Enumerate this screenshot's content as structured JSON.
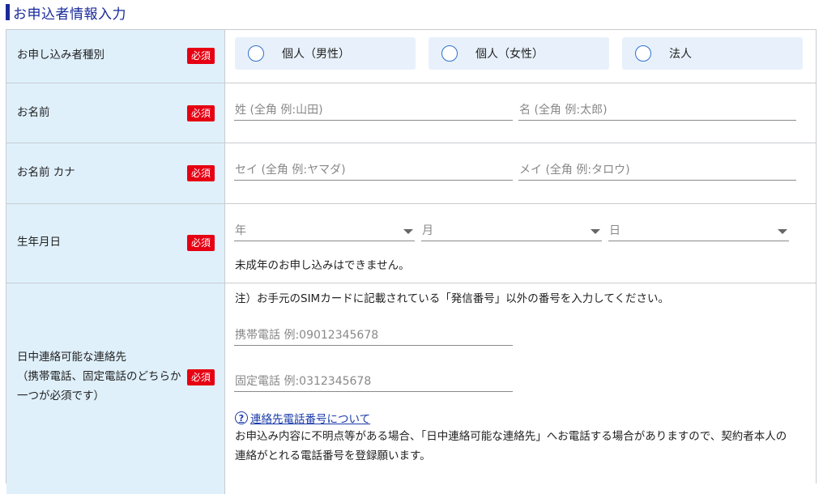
{
  "header": {
    "title": "お申込者情報入力"
  },
  "required_label": "必須",
  "rows": {
    "applicant_type": {
      "label": "お申し込み者種別",
      "options": [
        {
          "label": "個人（男性）"
        },
        {
          "label": "個人（女性）"
        },
        {
          "label": "法人"
        }
      ]
    },
    "name": {
      "label": "お名前",
      "last_placeholder": "姓 (全角 例:山田)",
      "first_placeholder": "名 (全角 例:太郎)"
    },
    "name_kana": {
      "label": "お名前 カナ",
      "last_placeholder": "セイ (全角 例:ヤマダ)",
      "first_placeholder": "メイ (全角 例:タロウ)"
    },
    "birthdate": {
      "label": "生年月日",
      "year": "年",
      "month": "月",
      "day": "日",
      "note": "未成年のお申し込みはできません。"
    },
    "contact": {
      "label_line1": "日中連絡可能な連絡先",
      "label_line2": "（携帯電話、固定電話のどちらか",
      "label_line3": "一つが必須です）",
      "notice": "注）お手元のSIMカードに記載されている「発信番号」以外の番号を入力してください。",
      "mobile_placeholder": "携帯電話 例:09012345678",
      "landline_placeholder": "固定電話 例:0312345678",
      "help_icon_text": "?",
      "help_link": "連絡先電話番号について",
      "description_line1": "お申込み内容に不明点等がある場合、「日中連絡可能な連絡先」へお電話する場合がありますので、契約者本人の",
      "description_line2": "連絡がとれる電話番号を登録願います。"
    }
  },
  "colors": {
    "accent": "#1a2a9a",
    "label_bg": "#dff0fb",
    "required_bg": "#e60012",
    "radio_bg": "#e8f1fb",
    "radio_border": "#2f6fd0",
    "link": "#1a3aa8"
  }
}
